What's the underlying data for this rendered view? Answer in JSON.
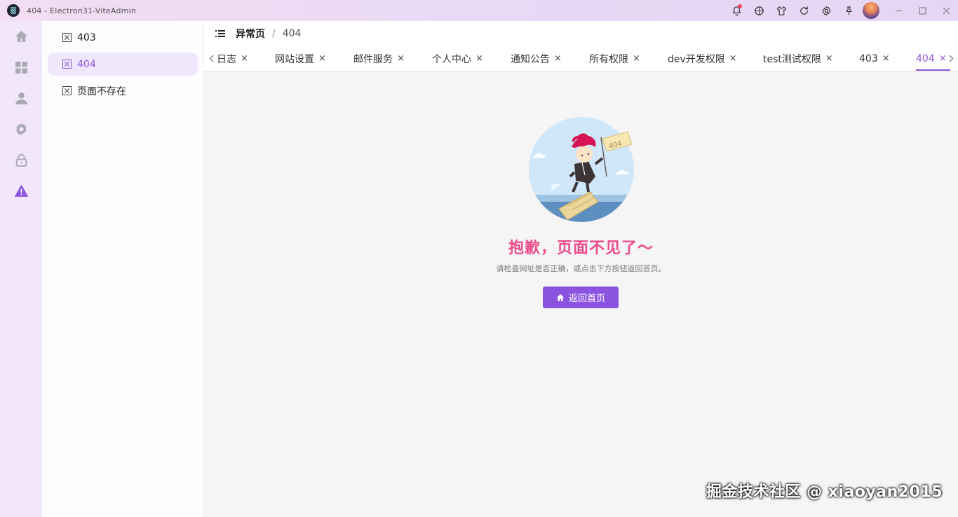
{
  "window": {
    "title": "404 - Electron31-ViteAdmin"
  },
  "header": {
    "breadcrumb": [
      "异常页",
      "404"
    ],
    "separator": "/"
  },
  "submenu": {
    "items": [
      {
        "label": "403",
        "active": false
      },
      {
        "label": "404",
        "active": true
      },
      {
        "label": "页面不存在",
        "active": false
      }
    ]
  },
  "tabs": [
    {
      "label": "日志",
      "close": "×"
    },
    {
      "label": "网站设置",
      "close": "×"
    },
    {
      "label": "邮件服务",
      "close": "×"
    },
    {
      "label": "个人中心",
      "close": "×"
    },
    {
      "label": "通知公告",
      "close": "×"
    },
    {
      "label": "所有权限",
      "close": "×"
    },
    {
      "label": "dev开发权限",
      "close": "×"
    },
    {
      "label": "test测试权限",
      "close": "×"
    },
    {
      "label": "403",
      "close": "×"
    },
    {
      "label": "404",
      "close": "×",
      "active": true
    }
  ],
  "error_page": {
    "illustration_label": "404",
    "title": "抱歉，页面不见了～",
    "description": "请检查网址是否正确，或点击下方按钮返回首页。",
    "home_button": "返回首页"
  },
  "watermark": "掘金技术社区 @ xiaoyan2015",
  "colors": {
    "accent": "#8b54e0",
    "title_pink": "#ec4c8c",
    "rail_bg": "#f1e6fb"
  }
}
